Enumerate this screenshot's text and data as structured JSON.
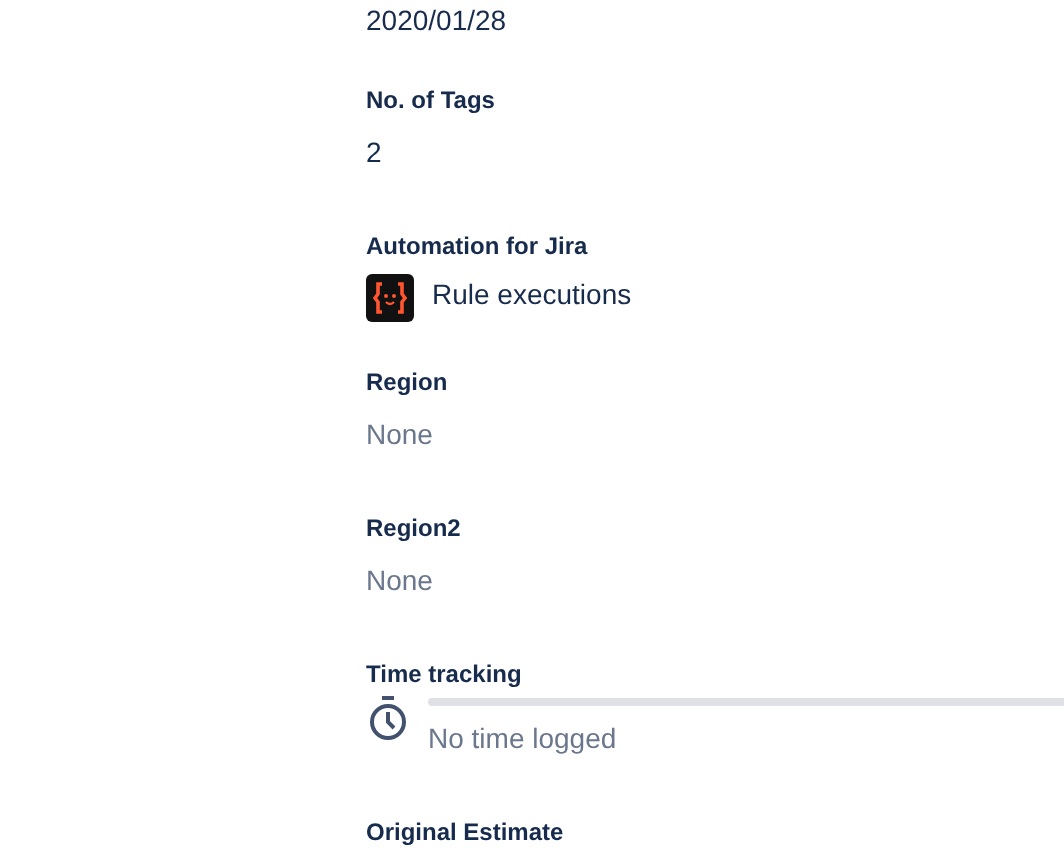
{
  "fields": [
    {
      "kind": "value",
      "value": "2020/01/28"
    },
    {
      "kind": "field",
      "label": "No. of Tags",
      "value": "2",
      "empty": false
    },
    {
      "kind": "app",
      "label": "Automation for Jira",
      "value": "Rule executions"
    },
    {
      "kind": "field",
      "label": "Region",
      "value": "None",
      "empty": true
    },
    {
      "kind": "field",
      "label": "Region2",
      "value": "None",
      "empty": true
    },
    {
      "kind": "time",
      "label": "Time tracking",
      "value": "No time logged",
      "level": 0
    },
    {
      "kind": "label",
      "label": "Original Estimate"
    }
  ]
}
